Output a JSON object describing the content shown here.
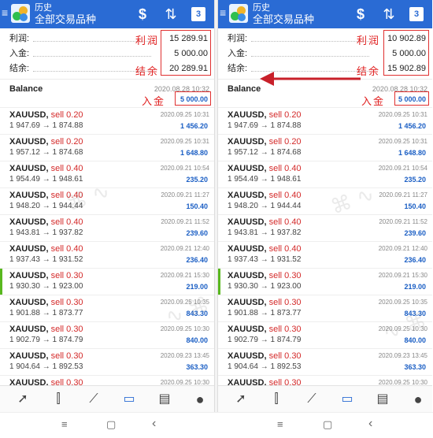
{
  "left": {
    "title": "历史",
    "subtitle": "全部交易品种",
    "calendar_day": "3",
    "summary": [
      {
        "label": "利润:",
        "value": "15 289.91"
      },
      {
        "label": "入金:",
        "value": "5 000.00"
      },
      {
        "label": "结余:",
        "value": "20 289.91"
      }
    ],
    "balance": {
      "name": "Balance",
      "date": "2020.08.28 10:32",
      "amount": "5 000.00"
    },
    "trades": [
      {
        "symbol": "XAUUSD,",
        "side": "sell 0.20",
        "prices": "1 947.69 → 1 874.88",
        "date": "2020.09.25 10:31",
        "profit": "1 456.20"
      },
      {
        "symbol": "XAUUSD,",
        "side": "sell 0.20",
        "prices": "1 957.12 → 1 874.68",
        "date": "2020.09.25 10:31",
        "profit": "1 648.80"
      },
      {
        "symbol": "XAUUSD,",
        "side": "sell 0.40",
        "prices": "1 954.49 → 1 948.61",
        "date": "2020.09.21 10:54",
        "profit": "235.20"
      },
      {
        "symbol": "XAUUSD,",
        "side": "sell 0.40",
        "prices": "1 948.20 → 1 944.44",
        "date": "2020.09.21 11:27",
        "profit": "150.40"
      },
      {
        "symbol": "XAUUSD,",
        "side": "sell 0.40",
        "prices": "1 943.81 → 1 937.82",
        "date": "2020.09.21 11:52",
        "profit": "239.60"
      },
      {
        "symbol": "XAUUSD,",
        "side": "sell 0.40",
        "prices": "1 937.43 → 1 931.52",
        "date": "2020.09.21 12:40",
        "profit": "236.40"
      },
      {
        "symbol": "XAUUSD,",
        "side": "sell 0.30",
        "prices": "1 930.30 → 1 923.00",
        "date": "2020.09.21 15:30",
        "profit": "219.00"
      },
      {
        "symbol": "XAUUSD,",
        "side": "sell 0.30",
        "prices": "1 901.88 → 1 873.77",
        "date": "2020.09.25 10:35",
        "profit": "843.30"
      },
      {
        "symbol": "XAUUSD,",
        "side": "sell 0.30",
        "prices": "1 902.79 → 1 874.79",
        "date": "2020.09.25 10:30",
        "profit": "840.00"
      },
      {
        "symbol": "XAUUSD,",
        "side": "sell 0.30",
        "prices": "1 904.64 → 1 892.53",
        "date": "2020.09.23 13:45",
        "profit": "363.30"
      },
      {
        "symbol": "XAUUSD,",
        "side": "sell 0.30",
        "prices": "",
        "date": "2020.09.25 10:30",
        "profit": ""
      }
    ],
    "annotations": {
      "profit": "利润",
      "balance": "结余",
      "deposit": "入金"
    }
  },
  "right": {
    "title": "历史",
    "subtitle": "全部交易品种",
    "calendar_day": "3",
    "summary": [
      {
        "label": "利润:",
        "value": "10 902.89"
      },
      {
        "label": "入金:",
        "value": "5 000.00"
      },
      {
        "label": "结余:",
        "value": "15 902.89"
      }
    ],
    "balance": {
      "name": "Balance",
      "date": "2020.08.28 10:32",
      "amount": "5 000.00"
    },
    "trades": [
      {
        "symbol": "XAUUSD,",
        "side": "sell 0.20",
        "prices": "1 947.69 → 1 874.88",
        "date": "2020.09.25 10:31",
        "profit": "1 456.20"
      },
      {
        "symbol": "XAUUSD,",
        "side": "sell 0.20",
        "prices": "1 957.12 → 1 874.68",
        "date": "2020.09.25 10:31",
        "profit": "1 648.80"
      },
      {
        "symbol": "XAUUSD,",
        "side": "sell 0.40",
        "prices": "1 954.49 → 1 948.61",
        "date": "2020.09.21 10:54",
        "profit": "235.20"
      },
      {
        "symbol": "XAUUSD,",
        "side": "sell 0.40",
        "prices": "1 948.20 → 1 944.44",
        "date": "2020.09.21 11:27",
        "profit": "150.40"
      },
      {
        "symbol": "XAUUSD,",
        "side": "sell 0.40",
        "prices": "1 943.81 → 1 937.82",
        "date": "2020.09.21 11:52",
        "profit": "239.60"
      },
      {
        "symbol": "XAUUSD,",
        "side": "sell 0.40",
        "prices": "1 937.43 → 1 931.52",
        "date": "2020.09.21 12:40",
        "profit": "236.40"
      },
      {
        "symbol": "XAUUSD,",
        "side": "sell 0.30",
        "prices": "1 930.30 → 1 923.00",
        "date": "2020.09.21 15:30",
        "profit": "219.00"
      },
      {
        "symbol": "XAUUSD,",
        "side": "sell 0.30",
        "prices": "1 901.88 → 1 873.77",
        "date": "2020.09.25 10:35",
        "profit": "843.30"
      },
      {
        "symbol": "XAUUSD,",
        "side": "sell 0.30",
        "prices": "1 902.79 → 1 874.79",
        "date": "2020.09.25 10:30",
        "profit": "840.00"
      },
      {
        "symbol": "XAUUSD,",
        "side": "sell 0.30",
        "prices": "1 904.64 → 1 892.53",
        "date": "2020.09.23 13:45",
        "profit": "363.30"
      },
      {
        "symbol": "XAUUSD,",
        "side": "sell 0.30",
        "prices": "",
        "date": "2020.09.25 10:30",
        "profit": ""
      }
    ],
    "annotations": {
      "profit": "利润",
      "balance": "结余",
      "deposit": "入金"
    }
  },
  "highlight_row": 6,
  "colors": {
    "appbar": "#2a6bd4",
    "sell": "#d42a2a",
    "profit": "#1a5ec4",
    "annotation": "#e02020",
    "highlight": "#59b81f"
  },
  "tab_icons": [
    "chart-arrow-icon",
    "candlestick-icon",
    "trend-lines-icon",
    "inbox-icon",
    "news-icon",
    "chat-icon"
  ],
  "active_tab": 3,
  "system_nav": {
    "menu": "≡",
    "home": "▢",
    "back": "‹"
  }
}
